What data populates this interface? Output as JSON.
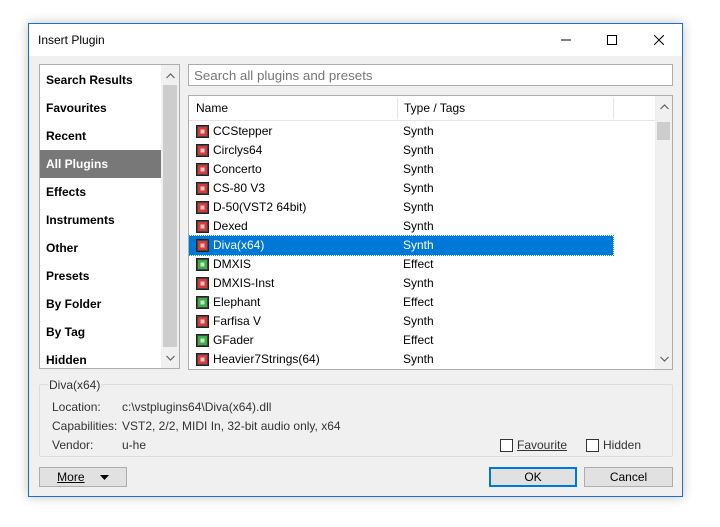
{
  "window": {
    "title": "Insert Plugin"
  },
  "search": {
    "placeholder": "Search all plugins and presets"
  },
  "sidebar": {
    "items": [
      {
        "label": "Search Results",
        "active": false
      },
      {
        "label": "Favourites",
        "active": false
      },
      {
        "label": "Recent",
        "active": false
      },
      {
        "label": "All Plugins",
        "active": true
      },
      {
        "label": "Effects",
        "active": false
      },
      {
        "label": "Instruments",
        "active": false
      },
      {
        "label": "Other",
        "active": false
      },
      {
        "label": "Presets",
        "active": false
      },
      {
        "label": "By Folder",
        "active": false
      },
      {
        "label": "By Tag",
        "active": false
      },
      {
        "label": "Hidden",
        "active": false
      }
    ]
  },
  "list": {
    "columns": {
      "name": "Name",
      "type": "Type / Tags"
    },
    "rows": [
      {
        "name": "CCStepper",
        "type": "Synth",
        "icon": "synth-plugin-icon",
        "selected": false
      },
      {
        "name": "Circlys64",
        "type": "Synth",
        "icon": "synth-plugin-icon",
        "selected": false
      },
      {
        "name": "Concerto",
        "type": "Synth",
        "icon": "synth-plugin-icon",
        "selected": false
      },
      {
        "name": "CS-80 V3",
        "type": "Synth",
        "icon": "synth-plugin-icon",
        "selected": false
      },
      {
        "name": "D-50(VST2 64bit)",
        "type": "Synth",
        "icon": "synth-plugin-icon",
        "selected": false
      },
      {
        "name": "Dexed",
        "type": "Synth",
        "icon": "synth-plugin-icon",
        "selected": false
      },
      {
        "name": "Diva(x64)",
        "type": "Synth",
        "icon": "synth-plugin-icon",
        "selected": true
      },
      {
        "name": "DMXIS",
        "type": "Effect",
        "icon": "effect-plugin-icon",
        "selected": false
      },
      {
        "name": "DMXIS-Inst",
        "type": "Synth",
        "icon": "synth-plugin-icon",
        "selected": false
      },
      {
        "name": "Elephant",
        "type": "Effect",
        "icon": "effect-plugin-icon",
        "selected": false
      },
      {
        "name": "Farfisa V",
        "type": "Synth",
        "icon": "synth-plugin-icon",
        "selected": false
      },
      {
        "name": "GFader",
        "type": "Effect",
        "icon": "effect-plugin-icon",
        "selected": false
      },
      {
        "name": "Heavier7Strings(64)",
        "type": "Synth",
        "icon": "synth-plugin-icon",
        "selected": false
      }
    ]
  },
  "details": {
    "title": "Diva(x64)",
    "location_label": "Location:",
    "location": "c:\\vstplugins64\\Diva(x64).dll",
    "capabilities_label": "Capabilities:",
    "capabilities": "VST2, 2/2, MIDI In, 32-bit audio only, x64",
    "vendor_label": "Vendor:",
    "vendor": "u-he",
    "favourite_label": "Favourite",
    "hidden_label": "Hidden"
  },
  "buttons": {
    "more": "More",
    "ok": "OK",
    "cancel": "Cancel"
  },
  "colors": {
    "accent": "#0078d7",
    "sidebar_active": "#787878",
    "synth_icon": "#d83a3a",
    "effect_icon": "#3cb043"
  }
}
